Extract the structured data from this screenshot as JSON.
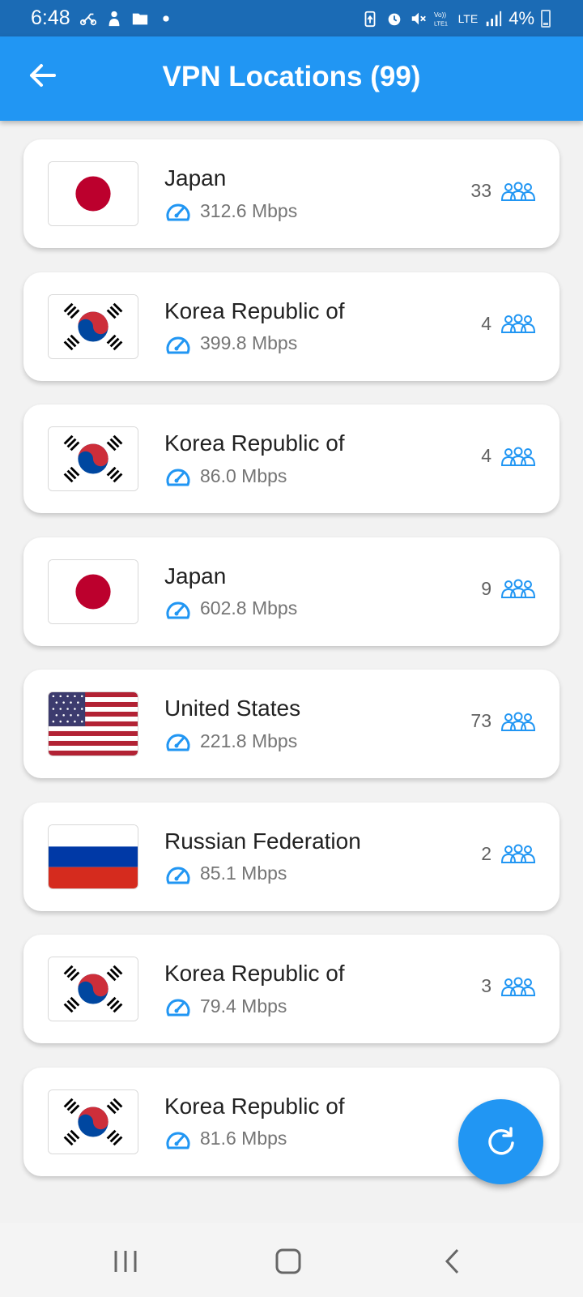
{
  "status_bar": {
    "time": "6:48",
    "battery": "4%",
    "network": "LTE",
    "left_icons": [
      "scooter-icon",
      "person-icon",
      "folder-icon",
      "dot-icon"
    ],
    "right_icons": [
      "battery-saver-icon",
      "alarm-icon",
      "mute-icon",
      "volte-icon",
      "lte-icon",
      "signal-icon"
    ]
  },
  "app_bar": {
    "title": "VPN Locations (99)",
    "back_icon": "arrow-left-icon",
    "color": "#2196f3"
  },
  "servers": [
    {
      "country": "Japan",
      "flag": "jp",
      "speed": "312.6 Mbps",
      "users": "33"
    },
    {
      "country": "Korea Republic of",
      "flag": "kr",
      "speed": "399.8 Mbps",
      "users": "4"
    },
    {
      "country": "Korea Republic of",
      "flag": "kr",
      "speed": "86.0 Mbps",
      "users": "4"
    },
    {
      "country": "Japan",
      "flag": "jp",
      "speed": "602.8 Mbps",
      "users": "9"
    },
    {
      "country": "United States",
      "flag": "us",
      "speed": "221.8 Mbps",
      "users": "73"
    },
    {
      "country": "Russian Federation",
      "flag": "ru",
      "speed": "85.1 Mbps",
      "users": "2"
    },
    {
      "country": "Korea Republic of",
      "flag": "kr",
      "speed": "79.4 Mbps",
      "users": "3"
    },
    {
      "country": "Korea Republic of",
      "flag": "kr",
      "speed": "81.6 Mbps",
      "users": ""
    }
  ],
  "fab": {
    "icon": "refresh-icon"
  },
  "nav_bar": {
    "icons": [
      "recent-apps-icon",
      "home-icon",
      "back-icon"
    ]
  },
  "colors": {
    "accent": "#2196f3",
    "status_bar": "#1b6bb5",
    "background": "#f2f2f2"
  }
}
